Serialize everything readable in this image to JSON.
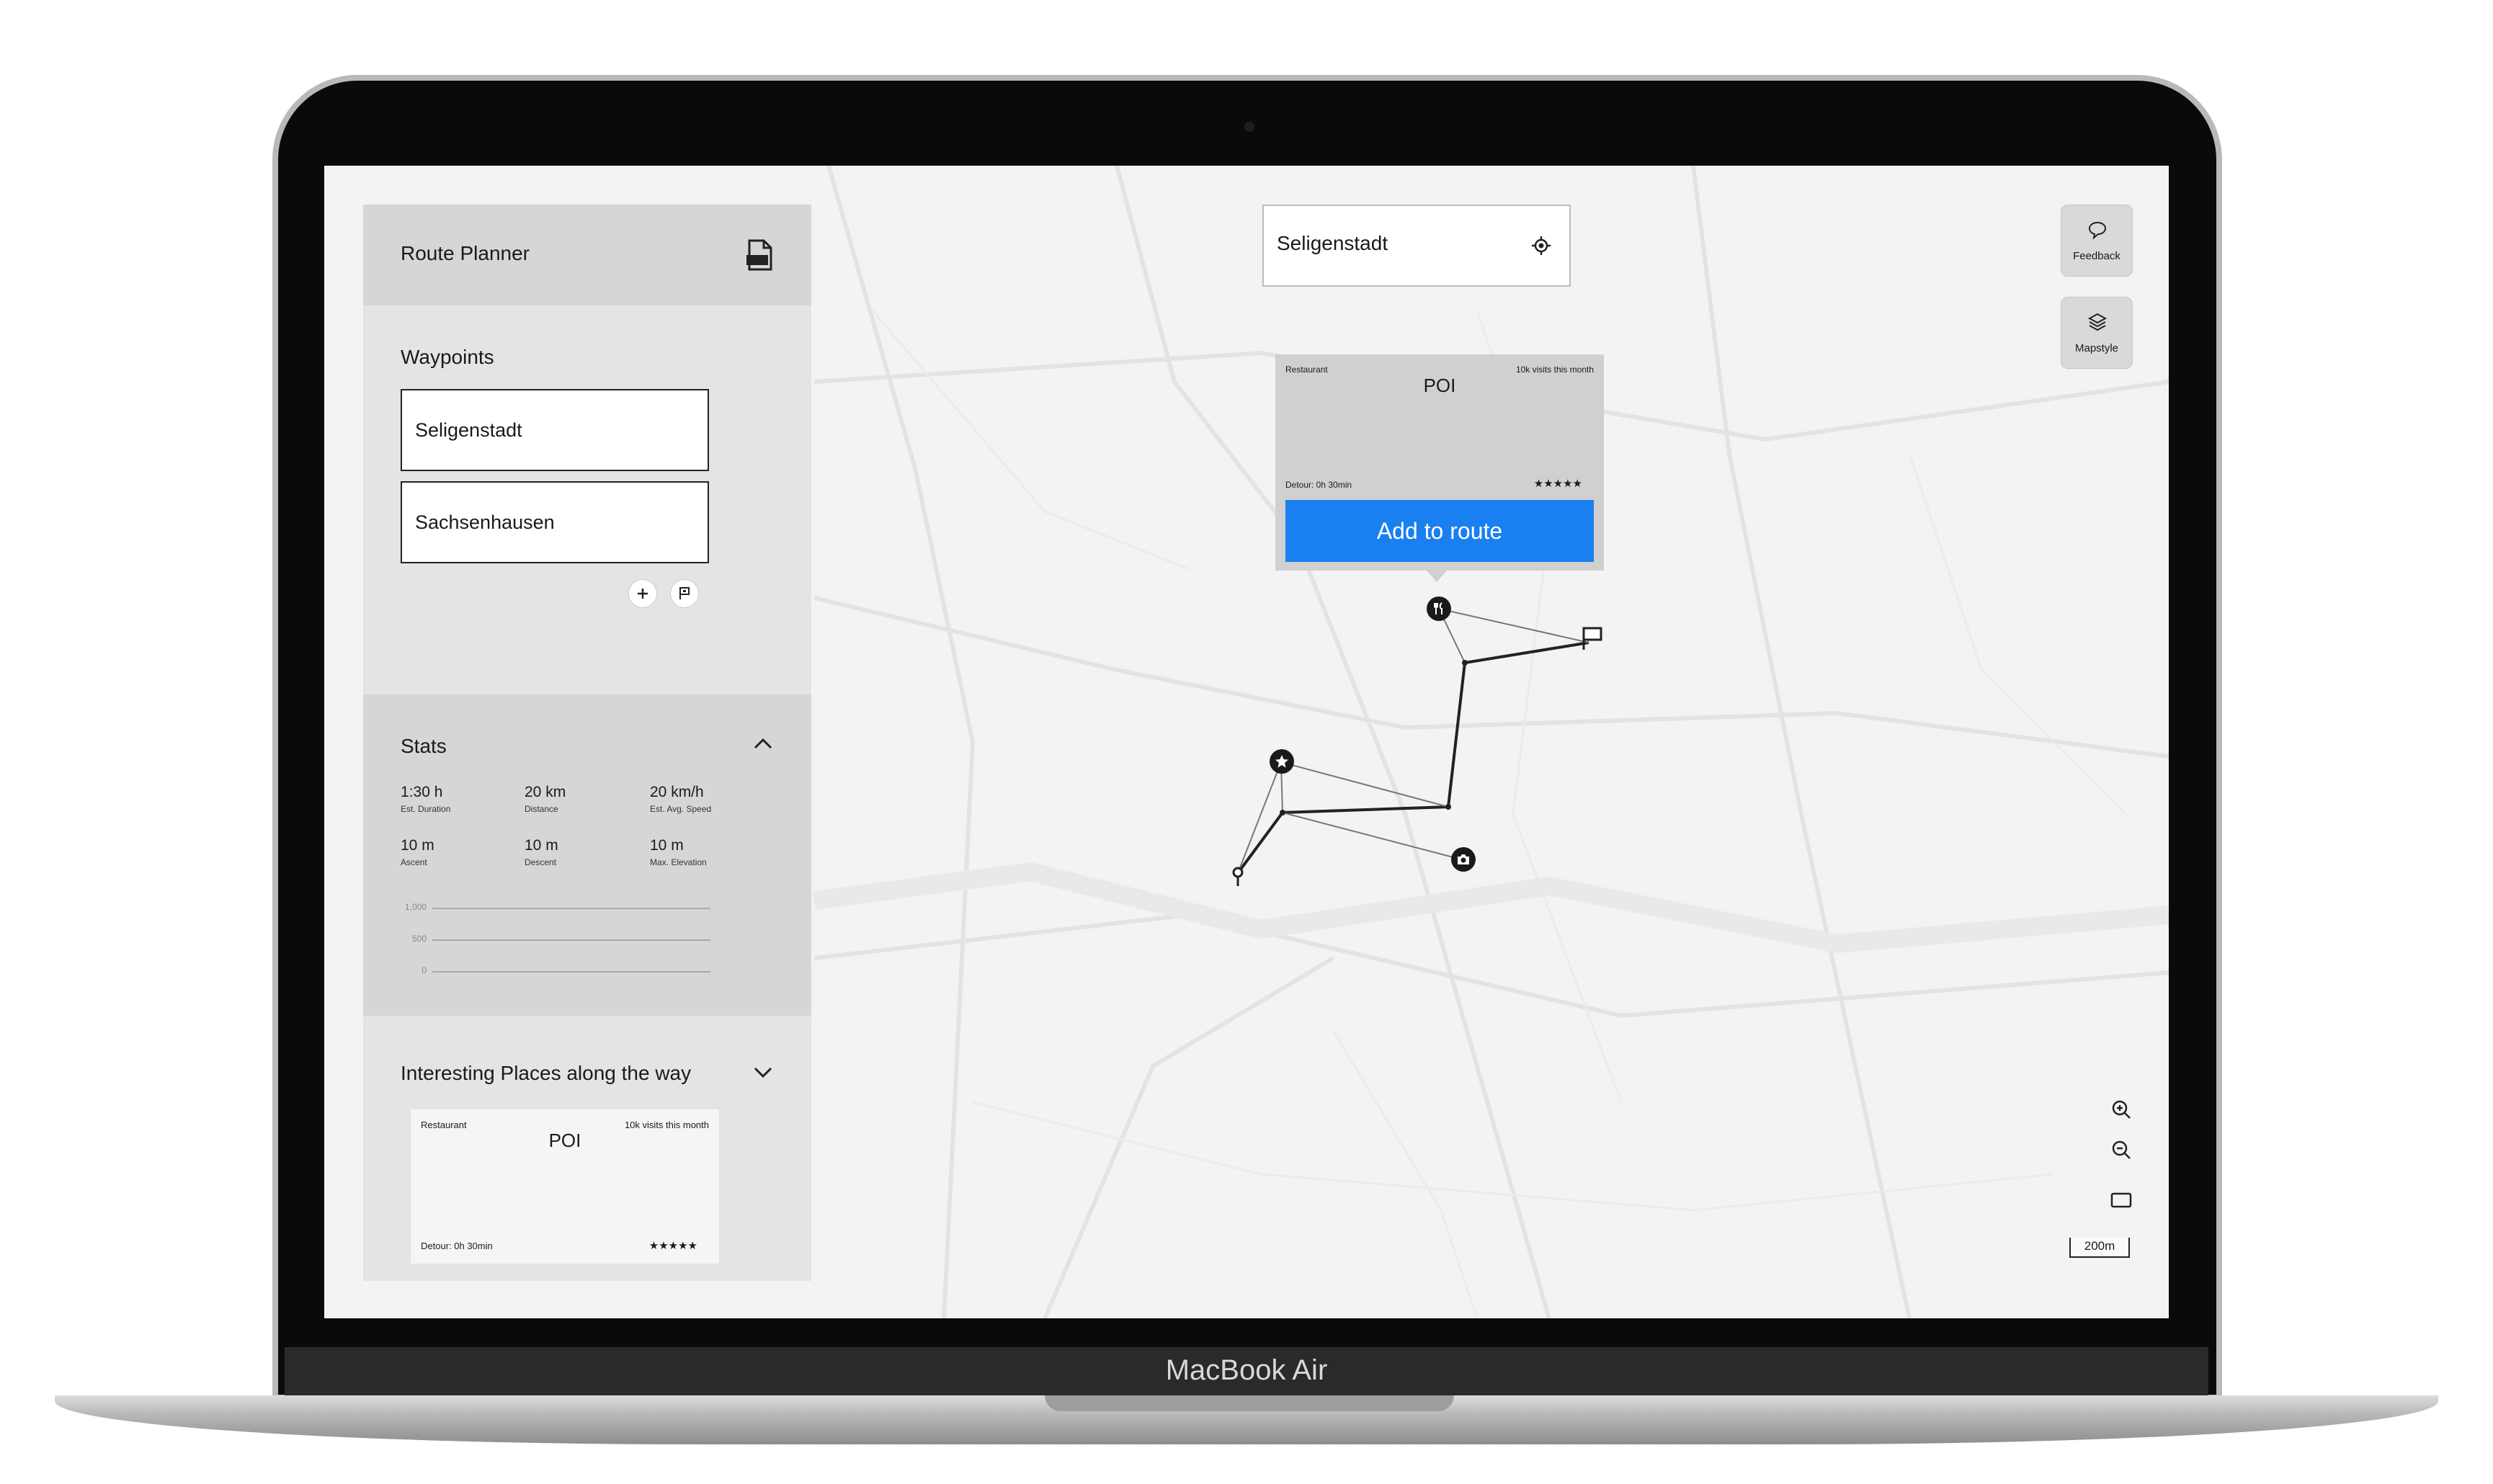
{
  "device": {
    "brand": "MacBook Air"
  },
  "sidebar": {
    "title": "Route Planner",
    "waypoints_label": "Waypoints",
    "waypoints": [
      "Seligenstadt",
      "Sachsenhausen"
    ],
    "stats": {
      "label": "Stats",
      "items": [
        {
          "value": "1:30 h",
          "label": "Est. Duration"
        },
        {
          "value": "20 km",
          "label": "Distance"
        },
        {
          "value": "20 km/h",
          "label": "Est. Avg. Speed"
        },
        {
          "value": "10 m",
          "label": "Ascent"
        },
        {
          "value": "10 m",
          "label": "Descent"
        },
        {
          "value": "10 m",
          "label": "Max. Elevation"
        }
      ],
      "elevation_ticks": [
        "1,000",
        "500",
        "0"
      ]
    },
    "places": {
      "label": "Interesting Places along the way",
      "card": {
        "category": "Restaurant",
        "visits": "10k visits this month",
        "title": "POI",
        "detour": "Detour: 0h 30min",
        "rating": "★★★★★"
      }
    }
  },
  "map": {
    "search_value": "Seligenstadt",
    "feedback_label": "Feedback",
    "mapstyle_label": "Mapstyle",
    "scale": "200m",
    "popup": {
      "category": "Restaurant",
      "visits": "10k visits this month",
      "title": "POI",
      "detour": "Detour: 0h 30min",
      "rating": "★★★★★",
      "button": "Add to route"
    }
  },
  "colors": {
    "accent": "#1a7ff0",
    "panel": "#e4e4e4",
    "panel_dark": "#d6d6d6"
  }
}
